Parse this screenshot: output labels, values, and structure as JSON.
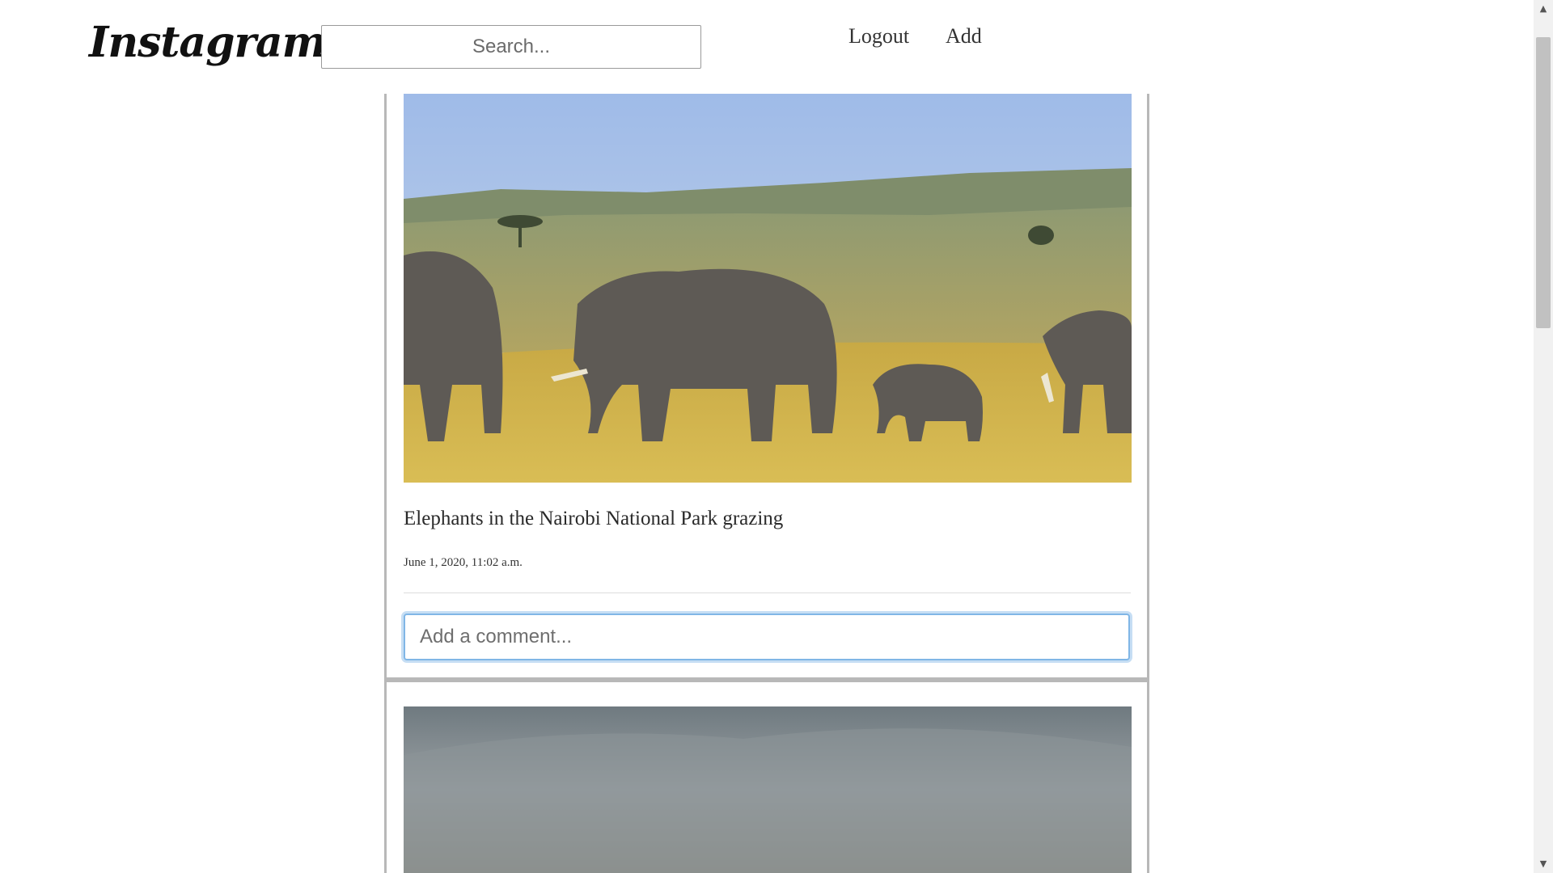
{
  "header": {
    "logo_text": "Instagram",
    "search_placeholder": "Search...",
    "nav": {
      "logout_label": "Logout",
      "add_label": "Add"
    }
  },
  "posts": [
    {
      "image_alt": "Elephants walking through savanna grassland",
      "caption": "Elephants in the Nairobi National Park grazing",
      "timestamp": "June 1, 2020, 11:02 a.m.",
      "comment_placeholder": "Add a comment..."
    },
    {
      "image_alt": "Hazy savanna landscape with hills"
    }
  ],
  "colors": {
    "border": "#b8b8b8",
    "focus_ring": "#80b6e6",
    "sky": "#a9c3ea",
    "grass": "#d4b24a"
  }
}
